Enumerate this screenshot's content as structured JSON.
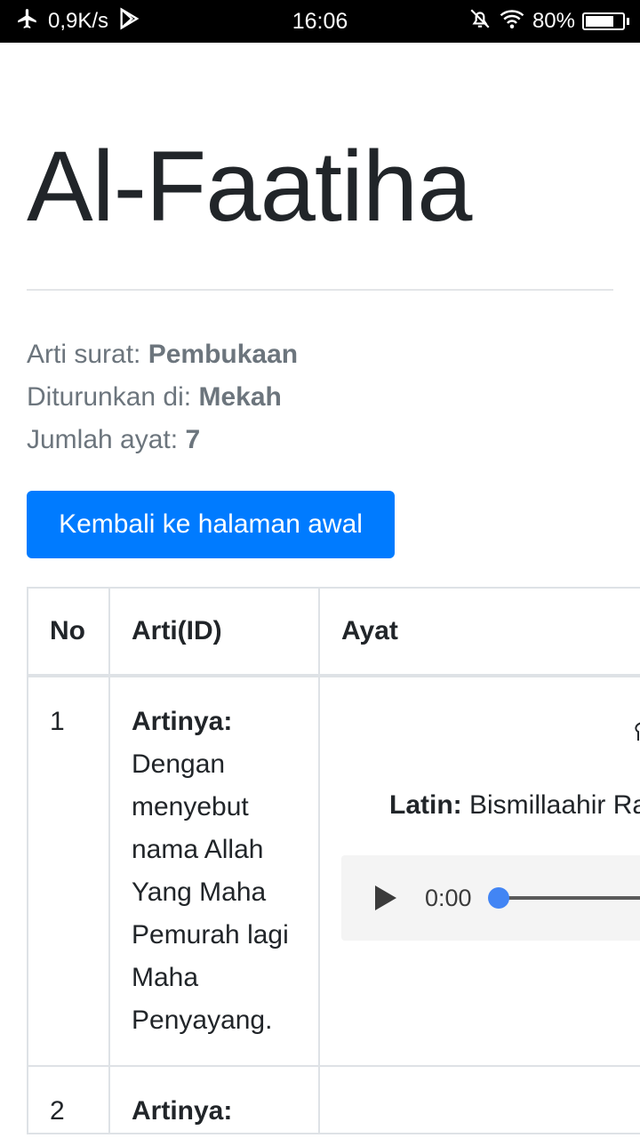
{
  "status_bar": {
    "network_speed": "0,9K/s",
    "time": "16:06",
    "battery_percent": "80%",
    "battery_level": 0.8
  },
  "surah": {
    "title": "Al-Faatiha",
    "meaning_label": "Arti surat:",
    "meaning": "Pembukaan",
    "revealed_label": "Diturunkan di:",
    "revealed": "Mekah",
    "verses_label": "Jumlah ayat:",
    "verses": "7"
  },
  "back_button": "Kembali ke halaman awal",
  "table": {
    "headers": [
      "No",
      "Arti(ID)",
      "Ayat"
    ],
    "rows": [
      {
        "no": "1",
        "arti_label": "Artinya:",
        "arti": "Dengan menyebut nama Allah Yang Maha Pemurah lagi Maha Penyayang.",
        "latin_label": "Latin:",
        "latin": "Bismillaahir Ra",
        "audio_time": "0:00"
      },
      {
        "no": "2",
        "arti_label": "Artinya:"
      }
    ]
  }
}
